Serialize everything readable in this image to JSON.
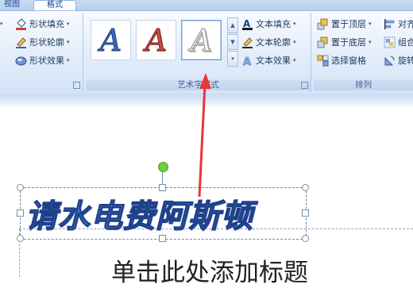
{
  "tabs": {
    "view": "视图",
    "format": "格式"
  },
  "shape_styles": {
    "fill": "形状填充",
    "outline": "形状轮廓",
    "effects": "形状效果"
  },
  "wordart_styles": {
    "label": "艺术字样式",
    "gallery": [
      {
        "letter": "A",
        "style": "blue-outline"
      },
      {
        "letter": "A",
        "style": "red-gradient"
      },
      {
        "letter": "A",
        "style": "white-shadow",
        "selected": true
      }
    ],
    "text_fill": "文本填充",
    "text_outline": "文本轮廓",
    "text_effects": "文本效果"
  },
  "arrange": {
    "label": "排列",
    "bring_to_front": "置于顶层",
    "send_to_back": "置于底层",
    "selection_pane": "选择窗格",
    "align": "对齐",
    "group": "组合",
    "rotate": "旋转"
  },
  "slide": {
    "wordart_text": "请水电费阿斯顿",
    "title_placeholder": "单击此处添加标题"
  },
  "colors": {
    "annotation_arrow": "#e8353a",
    "wordart_fill": "#4a7cd1",
    "rotation_handle": "#6fcf3f"
  }
}
